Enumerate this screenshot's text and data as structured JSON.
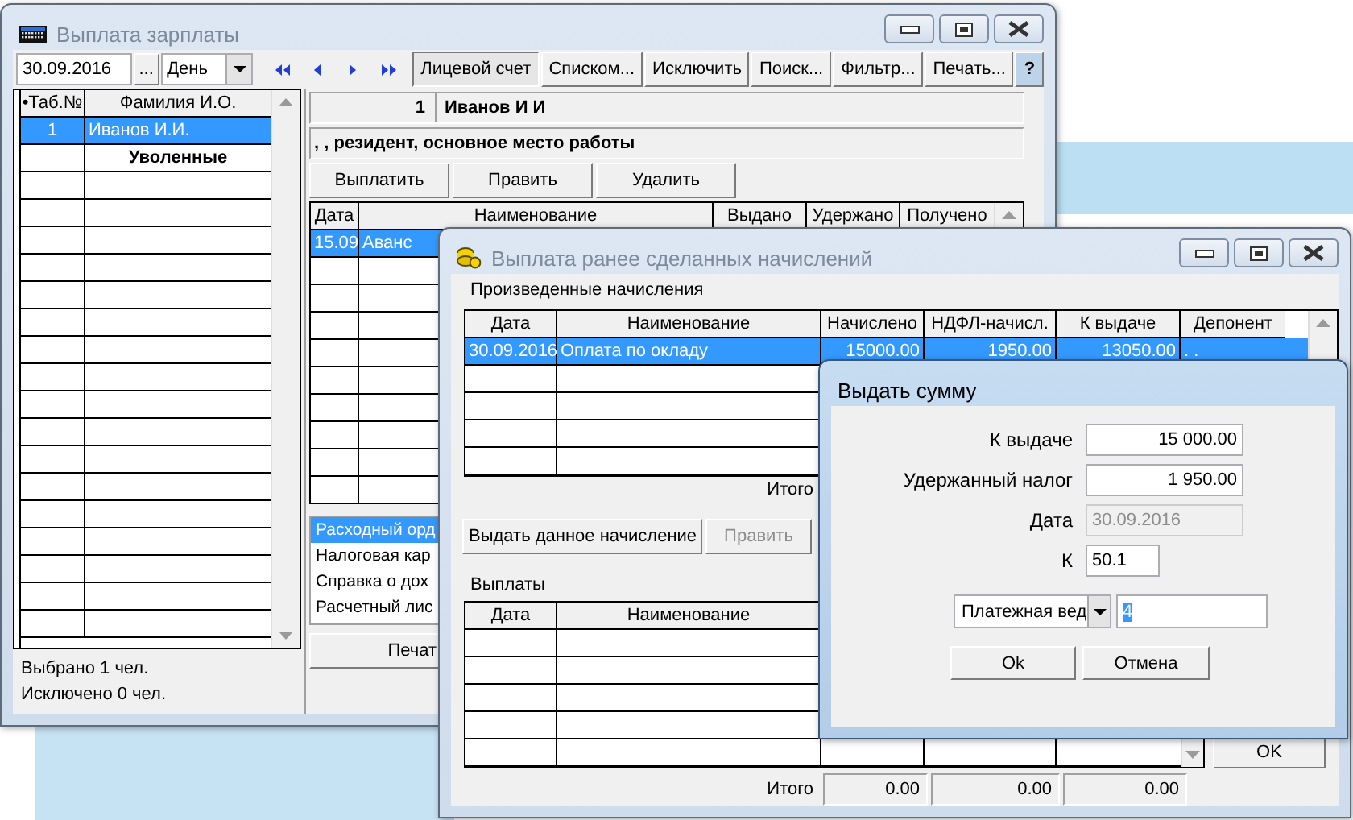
{
  "main_window": {
    "title": "Выплата зарплаты",
    "date": "30.09.2016",
    "date_button": "...",
    "period": "День",
    "toolbar_buttons": [
      {
        "label": "Лицевой счет",
        "selected": true
      },
      {
        "label": "Списком...",
        "selected": false
      },
      {
        "label": "Исключить",
        "selected": false
      },
      {
        "label": "Поиск...",
        "selected": false
      },
      {
        "label": "Фильтр...",
        "selected": false
      },
      {
        "label": "Печать...",
        "selected": false
      }
    ],
    "help_button": "?",
    "employees": {
      "columns": [
        "•Таб.№",
        "Фамилия И.О."
      ],
      "rows": [
        {
          "kind": "employee",
          "number": "1",
          "name": "Иванов И.И.",
          "selected": true
        },
        {
          "kind": "group",
          "name": "Уволенные",
          "selected": false
        }
      ]
    },
    "status": [
      "Выбрано 1 чел.",
      "Исключено 0 чел."
    ],
    "account": {
      "number": "1",
      "name": "Иванов И И",
      "details": ", , резидент, основное место работы"
    },
    "actions": [
      "Выплатить",
      "Править",
      "Удалить"
    ],
    "payments": {
      "columns": [
        "Дата",
        "Наименование",
        "Выдано",
        "Удержано",
        "Получено"
      ],
      "rows": [
        {
          "cells": [
            "15.09",
            "Аванс"
          ],
          "selected": true
        }
      ]
    },
    "documents": [
      {
        "label": "Расходный орд",
        "selected": true
      },
      {
        "label": "Налоговая кар",
        "selected": false
      },
      {
        "label": "Справка о дох",
        "selected": false
      },
      {
        "label": "Расчетный лис",
        "selected": false
      }
    ],
    "print_button": "Печат"
  },
  "accruals_window": {
    "title": "Выплата ранее сделанных начислений",
    "accruals_label": "Произведенные начисления",
    "accruals": {
      "columns": [
        "Дата",
        "Наименование",
        "Начислено",
        "НДФЛ-начисл.",
        "К выдаче",
        "Депонент"
      ],
      "rows": [
        {
          "cells": [
            "30.09.2016",
            "Оплата по окладу",
            "15000.00",
            "1950.00",
            "13050.00",
            ". ."
          ],
          "selected": true
        }
      ]
    },
    "total_label": "Итого",
    "buttons": [
      {
        "label": "Выдать данное начисление",
        "disabled": false
      },
      {
        "label": "Править",
        "disabled": true
      }
    ],
    "payments_label": "Выплаты",
    "payments": {
      "columns": [
        "Дата",
        "Наименование"
      ]
    },
    "payments_total_label": "Итого",
    "payments_totals": [
      "0.00",
      "0.00",
      "0.00"
    ],
    "ok_button": "OK"
  },
  "issue_dialog": {
    "title": "Выдать сумму",
    "fields": [
      {
        "kind": "amount",
        "label": "К выдаче",
        "value": "15 000.00",
        "disabled": false
      },
      {
        "kind": "amount",
        "label": "Удержанный налог",
        "value": "1 950.00",
        "disabled": false
      },
      {
        "kind": "text",
        "label": "Дата",
        "value": "30.09.2016",
        "disabled": true
      },
      {
        "kind": "short",
        "label": "К",
        "value": "50.1",
        "disabled": false
      }
    ],
    "document_type": "Платежная вед",
    "document_number": {
      "value": "4",
      "selected": true
    },
    "buttons": [
      "Ok",
      "Отмена"
    ]
  }
}
